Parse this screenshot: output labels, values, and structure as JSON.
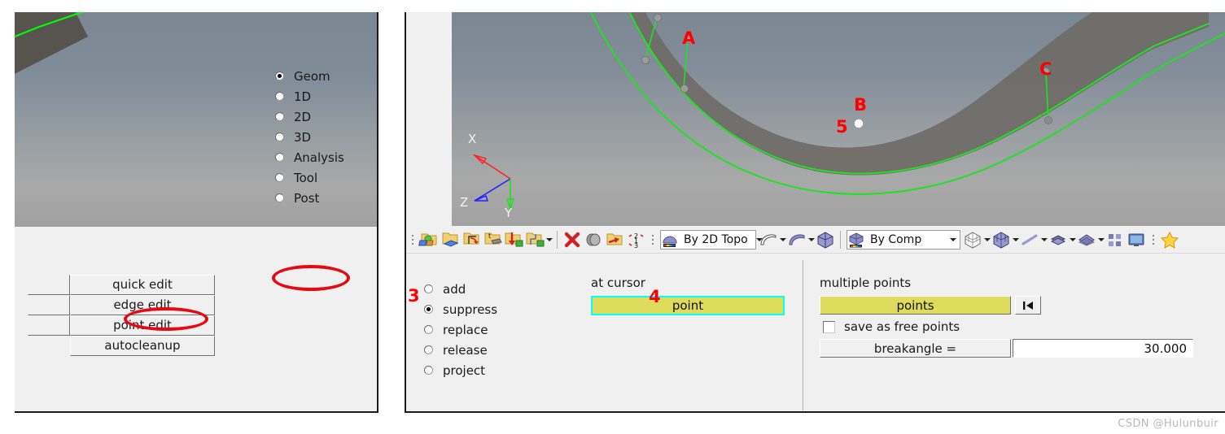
{
  "app": {
    "watermark": "CSDN @Hulunbuir"
  },
  "left_panel": {
    "buttons": [
      {
        "label": "quick edit"
      },
      {
        "label": "edge edit"
      },
      {
        "label": "point edit"
      },
      {
        "label": "autocleanup"
      }
    ],
    "module_radios": [
      {
        "label": "Geom",
        "selected": true
      },
      {
        "label": "1D",
        "selected": false
      },
      {
        "label": "2D",
        "selected": false
      },
      {
        "label": "3D",
        "selected": false
      },
      {
        "label": "Analysis",
        "selected": false
      },
      {
        "label": "Tool",
        "selected": false
      },
      {
        "label": "Post",
        "selected": false
      }
    ],
    "annotations": {
      "ellipse_geom": "highlight-geom",
      "ellipse_point_edit": "highlight-point-edit"
    }
  },
  "right_panel": {
    "viewport": {
      "labels": [
        {
          "text": "A"
        },
        {
          "text": "B"
        },
        {
          "text": "C"
        }
      ],
      "step_marker": "5",
      "axes": [
        {
          "text": "X",
          "color": "#ff0000"
        },
        {
          "text": "Y",
          "color": "#00ff00"
        },
        {
          "text": "Z",
          "color": "#0000ff"
        }
      ]
    },
    "toolbar": {
      "icons": [
        "geom-collectors-icon",
        "folder-surface-icon",
        "folder-history-icon",
        "folder-translate-icon",
        "folder-import-icon",
        "folder-organize-icon"
      ],
      "action_icons": [
        "delete-icon",
        "mask-icon",
        "folder-export-icon",
        "renumber-icon"
      ],
      "by_2d_topo": "By 2D Topo",
      "by_comp": "By Comp",
      "display_icons": [
        "surface-icon",
        "surface-shaded-icon",
        "solid-icon",
        "wireframe-cube-icon",
        "shaded-cube-icon",
        "line-icon",
        "shell-icon",
        "plane-icon",
        "elements-icon",
        "screen-icon",
        "favorite-star-icon"
      ]
    },
    "mode_radios": [
      {
        "label": "add",
        "selected": false
      },
      {
        "label": "suppress",
        "selected": true
      },
      {
        "label": "replace",
        "selected": false
      },
      {
        "label": "release",
        "selected": false
      },
      {
        "label": "project",
        "selected": false
      }
    ],
    "at_cursor": {
      "title": "at cursor",
      "button_label": "point"
    },
    "multiple_points": {
      "title": "multiple points",
      "button_label": "points",
      "rewind_icon": "rewind-icon",
      "save_free_points_label": "save as free points",
      "save_free_points_checked": false,
      "breakangle_label": "breakangle =",
      "breakangle_value": "30.000"
    },
    "markers": {
      "m3": "3",
      "m4": "4"
    }
  },
  "colors": {
    "panel_bg": "#f0f0f0",
    "annotation_red": "#ff0000",
    "highlight_yellow": "#dfdc5c",
    "focus_cyan": "#00ffff",
    "mesh_green": "#00ff00"
  }
}
